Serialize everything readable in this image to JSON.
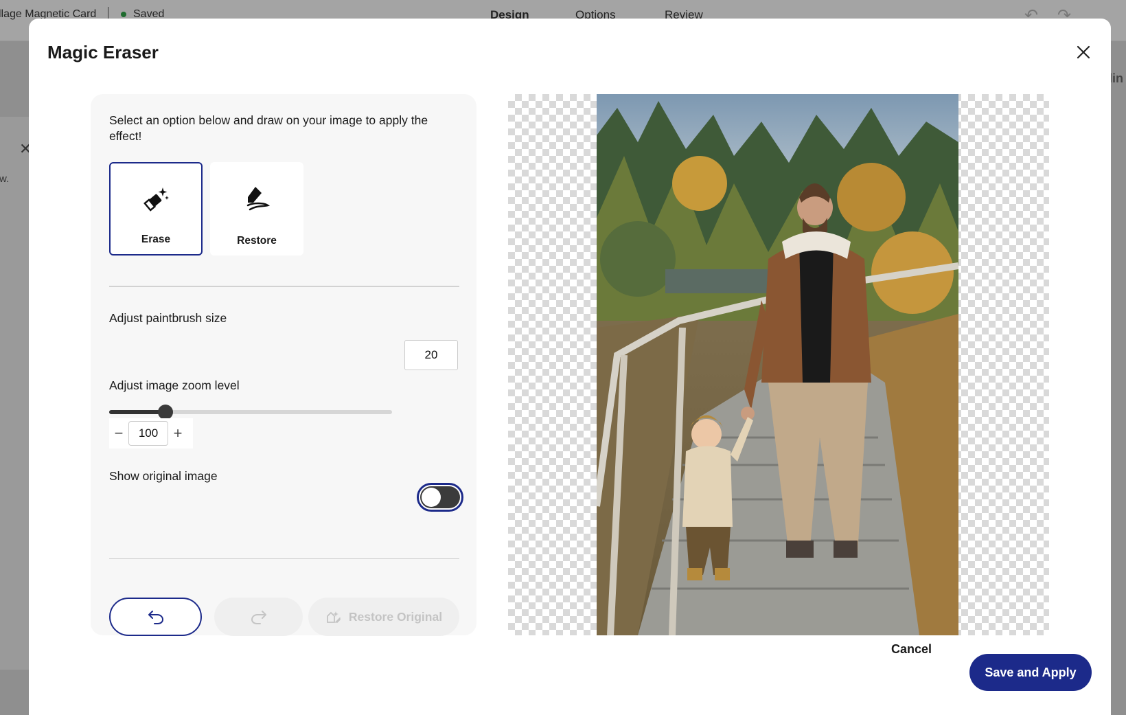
{
  "background": {
    "document_title": "llage Magnetic Card",
    "save_status": "Saved",
    "tabs": [
      {
        "label": "Design",
        "active": true
      },
      {
        "label": "Options",
        "active": false
      },
      {
        "label": "Review",
        "active": false
      }
    ],
    "left_fragment": "w.",
    "right_fragment": "ellin"
  },
  "modal": {
    "title": "Magic Eraser",
    "instruction": "Select an option below and draw on your image to apply the effect!",
    "tools": [
      {
        "label": "Erase",
        "icon": "eraser-sparkle-icon",
        "selected": true
      },
      {
        "label": "Restore",
        "icon": "restore-brush-icon",
        "selected": false
      }
    ],
    "brush": {
      "label": "Adjust paintbrush size",
      "value": "20",
      "slider_fraction": 0.2
    },
    "zoom": {
      "label": "Adjust image zoom level",
      "value": "100",
      "minus": "−",
      "plus": "+"
    },
    "show_original": {
      "label": "Show original image",
      "on": false
    },
    "actions": {
      "undo_icon": "undo-icon",
      "redo_icon": "redo-icon",
      "restore_original_label": "Restore Original"
    },
    "footer": {
      "cancel_label": "Cancel",
      "save_label": "Save and Apply"
    }
  },
  "colors": {
    "primary": "#1c2a8a",
    "saved_dot": "#1e6b2e"
  }
}
